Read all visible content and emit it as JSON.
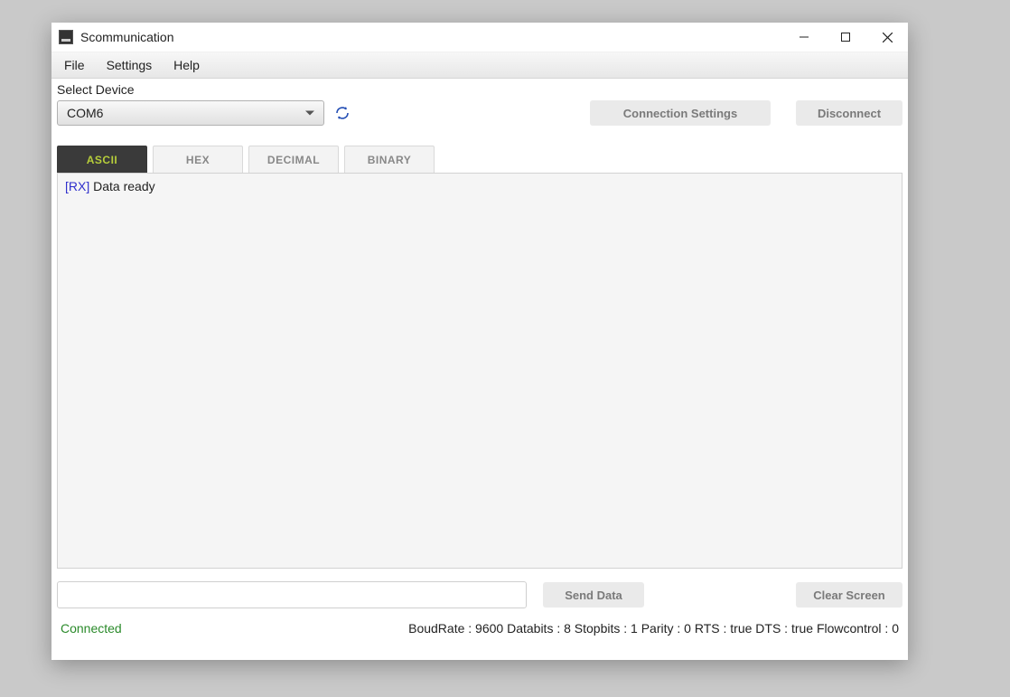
{
  "window": {
    "title": "Scommunication"
  },
  "menubar": {
    "items": [
      "File",
      "Settings",
      "Help"
    ]
  },
  "device": {
    "label": "Select Device",
    "selected": "COM6"
  },
  "buttons": {
    "connection_settings": "Connection Settings",
    "disconnect": "Disconnect",
    "send_data": "Send Data",
    "clear_screen": "Clear Screen"
  },
  "tabs": {
    "items": [
      "ASCII",
      "HEX",
      "DECIMAL",
      "BINARY"
    ],
    "active_index": 0
  },
  "console": {
    "entries": [
      {
        "tag": "[RX]",
        "text": " Data ready"
      }
    ]
  },
  "send_input": {
    "value": ""
  },
  "status": {
    "connection": "Connected",
    "info": "BoudRate : 9600 Databits : 8 Stopbits : 1 Parity : 0 RTS : true DTS : true Flowcontrol : 0"
  }
}
